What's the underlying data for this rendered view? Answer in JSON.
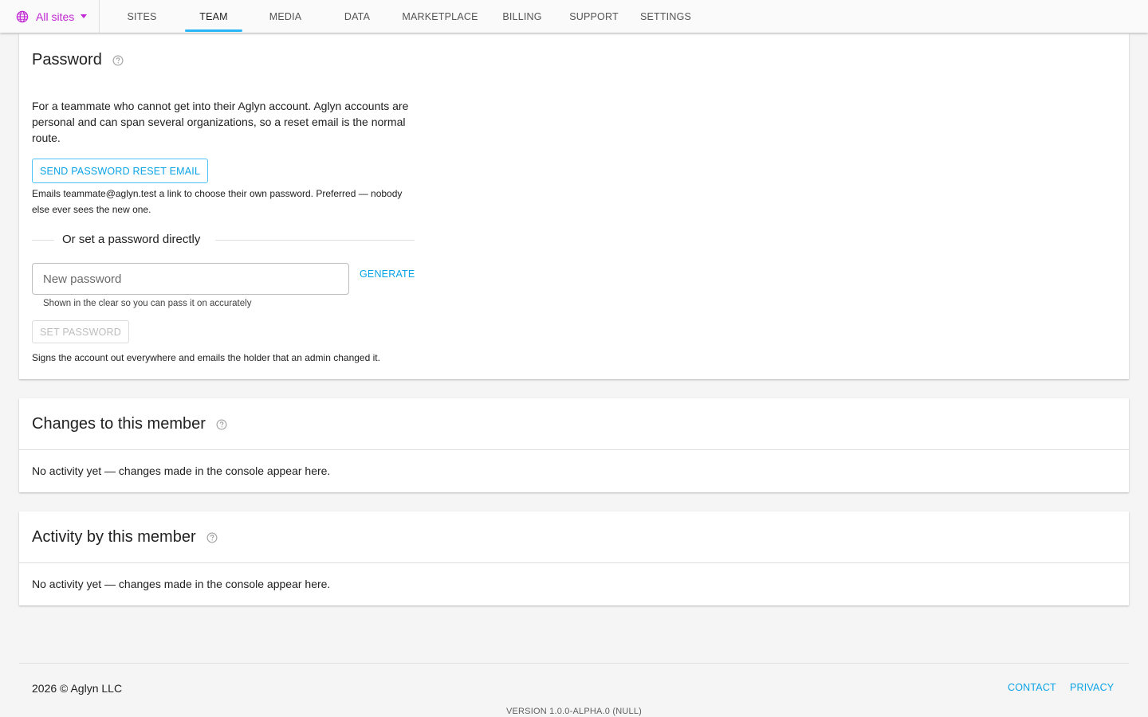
{
  "nav": {
    "site_picker": "All sites",
    "tabs": [
      {
        "label": "SITES"
      },
      {
        "label": "TEAM"
      },
      {
        "label": "MEDIA"
      },
      {
        "label": "DATA"
      },
      {
        "label": "MARKETPLACE"
      },
      {
        "label": "BILLING"
      },
      {
        "label": "SUPPORT"
      },
      {
        "label": "SETTINGS"
      }
    ],
    "active_tab": "TEAM"
  },
  "password_card": {
    "title": "Password",
    "description": "For a teammate who cannot get into their Aglyn account. Aglyn accounts are personal and can span several organizations, so a reset email is the normal route.",
    "reset_button": "SEND PASSWORD RESET EMAIL",
    "reset_note": "Emails teammate@aglyn.test a link to choose their own password. Preferred — nobody else ever sees the new one.",
    "divider_label": "Or set a password directly",
    "input_placeholder": "New password",
    "generate_button": "GENERATE",
    "input_hint": "Shown in the clear so you can pass it on accurately",
    "set_button": "SET PASSWORD",
    "set_note": "Signs the account out everywhere and emails the holder that an admin changed it."
  },
  "changes_card": {
    "title": "Changes to this member",
    "empty": "No activity yet — changes made in the console appear here."
  },
  "activity_card": {
    "title": "Activity by this member",
    "empty": "No activity yet — changes made in the console appear here."
  },
  "footer": {
    "copyright": "2026 © Aglyn LLC",
    "contact": "CONTACT",
    "privacy": "PRIVACY",
    "version": "VERSION 1.0.0-ALPHA.0 (NULL)"
  },
  "colors": {
    "accent": "#0aa3e6",
    "site_picker": "#c026d3",
    "tab_indicator": "#29b6f6"
  }
}
